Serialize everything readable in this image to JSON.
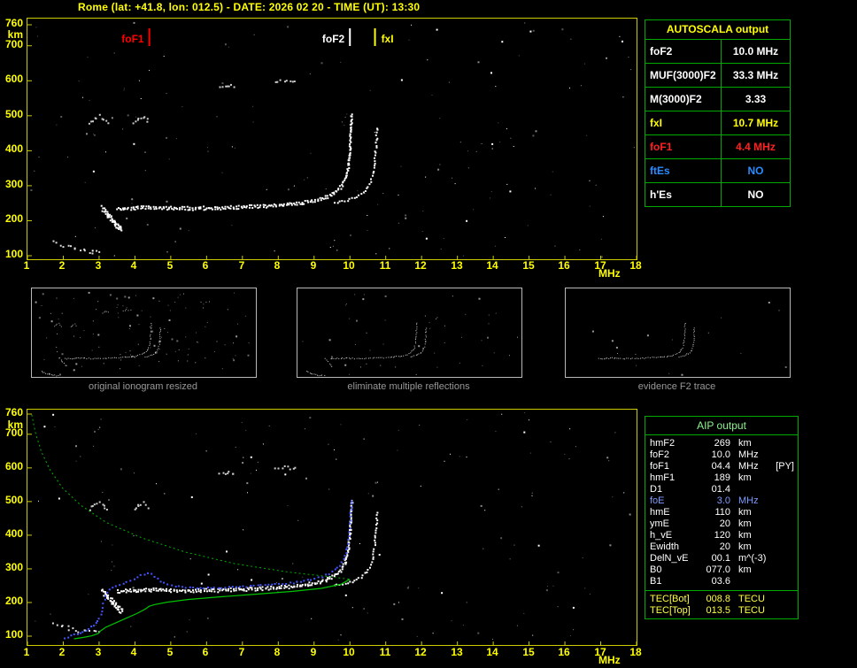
{
  "title": "Rome (lat: +41.8, lon: 012.5) - DATE: 2026 02 20 - TIME (UT): 13:30",
  "autoscala": {
    "header": "AUTOSCALA output",
    "rows": [
      {
        "label": "foF2",
        "value": "10.0 MHz",
        "color": "#ffffff"
      },
      {
        "label": "MUF(3000)F2",
        "value": "33.3 MHz",
        "color": "#ffffff"
      },
      {
        "label": "M(3000)F2",
        "value": "3.33",
        "color": "#ffffff"
      },
      {
        "label": "fxI",
        "value": "10.7 MHz",
        "color": "#ffff00"
      },
      {
        "label": "foF1",
        "value": "4.4 MHz",
        "color": "#ff2020"
      },
      {
        "label": "ftEs",
        "value": "NO",
        "color": "#2a8cff"
      },
      {
        "label": "h'Es",
        "value": "NO",
        "color": "#ffffff"
      }
    ]
  },
  "aip": {
    "header": "AIP output",
    "rows": [
      {
        "param": "hmF2",
        "value": "269",
        "unit": "km",
        "extra": "",
        "color": "#ffffff"
      },
      {
        "param": "foF2",
        "value": "10.0",
        "unit": "MHz",
        "extra": "",
        "color": "#ffffff"
      },
      {
        "param": "foF1",
        "value": "04.4",
        "unit": "MHz",
        "extra": "[PY]",
        "color": "#ffffff"
      },
      {
        "param": "hmF1",
        "value": "189",
        "unit": "km",
        "extra": "",
        "color": "#ffffff"
      },
      {
        "param": "D1",
        "value": "01.4",
        "unit": "",
        "extra": "",
        "color": "#ffffff"
      },
      {
        "param": "foE",
        "value": "3.0",
        "unit": "MHz",
        "extra": "",
        "color": "#7d9bff"
      },
      {
        "param": "hmE",
        "value": "110",
        "unit": "km",
        "extra": "",
        "color": "#ffffff"
      },
      {
        "param": "ymE",
        "value": "20",
        "unit": "km",
        "extra": "",
        "color": "#ffffff"
      },
      {
        "param": "h_vE",
        "value": "120",
        "unit": "km",
        "extra": "",
        "color": "#ffffff"
      },
      {
        "param": "Ewidth",
        "value": "20",
        "unit": "km",
        "extra": "",
        "color": "#ffffff"
      },
      {
        "param": "DelN_vE",
        "value": "00.1",
        "unit": "m^(-3)",
        "extra": "",
        "color": "#ffffff"
      },
      {
        "param": "B0",
        "value": "077.0",
        "unit": "km",
        "extra": "",
        "color": "#ffffff"
      },
      {
        "param": "B1",
        "value": "03.6",
        "unit": "",
        "extra": "",
        "color": "#ffffff"
      }
    ],
    "tec_rows": [
      {
        "param": "TEC[Bot]",
        "value": "008.8",
        "unit": "TECU",
        "extra": "",
        "color": "#ffff40"
      },
      {
        "param": "TEC[Top]",
        "value": "013.5",
        "unit": "TECU",
        "extra": "",
        "color": "#ffff40"
      }
    ]
  },
  "thumbnails": [
    {
      "caption": "original ionogram resized"
    },
    {
      "caption": "eliminate multiple reflections"
    },
    {
      "caption": "evidence F2 trace"
    }
  ],
  "chart_data": {
    "type": "scatter",
    "description": "Vertical-incidence ionogram, virtual height (km) vs sounding frequency (MHz), with AIP electron-density profile and fitted trace",
    "x_unit": "MHz",
    "y_unit": "km",
    "x_range": [
      1,
      18
    ],
    "y_range": [
      100,
      760
    ],
    "x_ticks": [
      1,
      2,
      3,
      4,
      5,
      6,
      7,
      8,
      9,
      10,
      11,
      12,
      13,
      14,
      15,
      16,
      17,
      18
    ],
    "y_ticks": [
      760,
      700,
      600,
      500,
      400,
      300,
      200,
      100
    ],
    "markers": [
      {
        "label": "foF1",
        "freq": 4.4,
        "color": "#ff0000",
        "side": "left"
      },
      {
        "label": "foF2",
        "freq": 10.0,
        "color": "#ffffff",
        "side": "left"
      },
      {
        "label": "fxI",
        "freq": 10.7,
        "color": "#ffff00",
        "side": "right"
      }
    ],
    "traces": {
      "o_trace": [
        [
          3.5,
          238
        ],
        [
          4.0,
          241
        ],
        [
          4.5,
          243
        ],
        [
          5.0,
          241
        ],
        [
          5.6,
          240
        ],
        [
          6.2,
          241
        ],
        [
          6.8,
          243
        ],
        [
          7.4,
          246
        ],
        [
          8.0,
          249
        ],
        [
          8.5,
          254
        ],
        [
          9.0,
          262
        ],
        [
          9.3,
          271
        ],
        [
          9.55,
          284
        ],
        [
          9.72,
          300
        ],
        [
          9.84,
          322
        ],
        [
          9.92,
          352
        ],
        [
          9.97,
          395
        ],
        [
          10.0,
          448
        ],
        [
          10.03,
          505
        ]
      ],
      "x_trace": [
        [
          9.55,
          252
        ],
        [
          9.85,
          259
        ],
        [
          10.1,
          267
        ],
        [
          10.3,
          278
        ],
        [
          10.45,
          293
        ],
        [
          10.56,
          314
        ],
        [
          10.64,
          345
        ],
        [
          10.69,
          388
        ],
        [
          10.72,
          432
        ],
        [
          10.74,
          468
        ]
      ],
      "f_cusp": [
        [
          3.08,
          242
        ],
        [
          3.18,
          230
        ],
        [
          3.28,
          217
        ],
        [
          3.4,
          203
        ],
        [
          3.52,
          190
        ],
        [
          3.6,
          184
        ]
      ],
      "e_trace": [
        [
          1.7,
          145
        ],
        [
          2.0,
          130
        ],
        [
          2.35,
          120
        ],
        [
          2.7,
          114
        ],
        [
          3.0,
          112
        ]
      ],
      "second_hops": [
        [
          [
            2.7,
            480
          ],
          [
            2.85,
            494
          ],
          [
            3.0,
            502
          ],
          [
            3.12,
            490
          ],
          [
            3.2,
            478
          ]
        ],
        [
          [
            3.95,
            478
          ],
          [
            4.1,
            492
          ],
          [
            4.22,
            500
          ],
          [
            4.35,
            486
          ]
        ],
        [
          [
            6.35,
            582
          ],
          [
            6.55,
            590
          ],
          [
            6.75,
            586
          ]
        ],
        [
          [
            7.9,
            598
          ],
          [
            8.15,
            604
          ],
          [
            8.45,
            600
          ]
        ]
      ]
    },
    "profile_topside": [
      [
        1.12,
        758
      ],
      [
        1.22,
        706
      ],
      [
        1.38,
        650
      ],
      [
        1.62,
        596
      ],
      [
        1.98,
        540
      ],
      [
        2.5,
        488
      ],
      [
        3.2,
        438
      ],
      [
        4.2,
        392
      ],
      [
        5.4,
        350
      ],
      [
        6.8,
        315
      ],
      [
        8.3,
        290
      ],
      [
        9.4,
        277
      ],
      [
        10.0,
        269
      ]
    ],
    "profile_bottomside": [
      [
        10.0,
        269
      ],
      [
        9.75,
        254
      ],
      [
        9.2,
        242
      ],
      [
        8.4,
        233
      ],
      [
        7.4,
        225
      ],
      [
        6.4,
        217
      ],
      [
        5.5,
        209
      ],
      [
        4.9,
        201
      ],
      [
        4.55,
        194
      ],
      [
        4.4,
        189
      ],
      [
        4.28,
        180
      ],
      [
        4.05,
        167
      ],
      [
        3.75,
        153
      ],
      [
        3.45,
        139
      ],
      [
        3.18,
        126
      ],
      [
        3.02,
        114
      ],
      [
        2.98,
        108
      ],
      [
        2.8,
        101
      ],
      [
        2.55,
        96
      ],
      [
        2.3,
        92
      ]
    ],
    "fitted_trace": [
      [
        2.0,
        96
      ],
      [
        2.2,
        103
      ],
      [
        2.45,
        112
      ],
      [
        2.7,
        124
      ],
      [
        2.9,
        140
      ],
      [
        3.02,
        165
      ],
      [
        3.1,
        200
      ],
      [
        3.2,
        232
      ],
      [
        3.35,
        247
      ],
      [
        3.55,
        254
      ],
      [
        3.75,
        262
      ],
      [
        3.95,
        272
      ],
      [
        4.15,
        283
      ],
      [
        4.32,
        291
      ],
      [
        4.45,
        287
      ],
      [
        4.6,
        272
      ],
      [
        4.8,
        260
      ],
      [
        5.0,
        253
      ],
      [
        5.4,
        248
      ],
      [
        5.9,
        246
      ],
      [
        6.4,
        247
      ],
      [
        6.9,
        249
      ],
      [
        7.4,
        252
      ],
      [
        7.9,
        256
      ],
      [
        8.4,
        261
      ],
      [
        8.9,
        270
      ],
      [
        9.2,
        279
      ],
      [
        9.5,
        293
      ],
      [
        9.7,
        312
      ],
      [
        9.85,
        340
      ],
      [
        9.93,
        378
      ],
      [
        9.98,
        425
      ],
      [
        10.01,
        478
      ],
      [
        10.03,
        505
      ]
    ]
  }
}
